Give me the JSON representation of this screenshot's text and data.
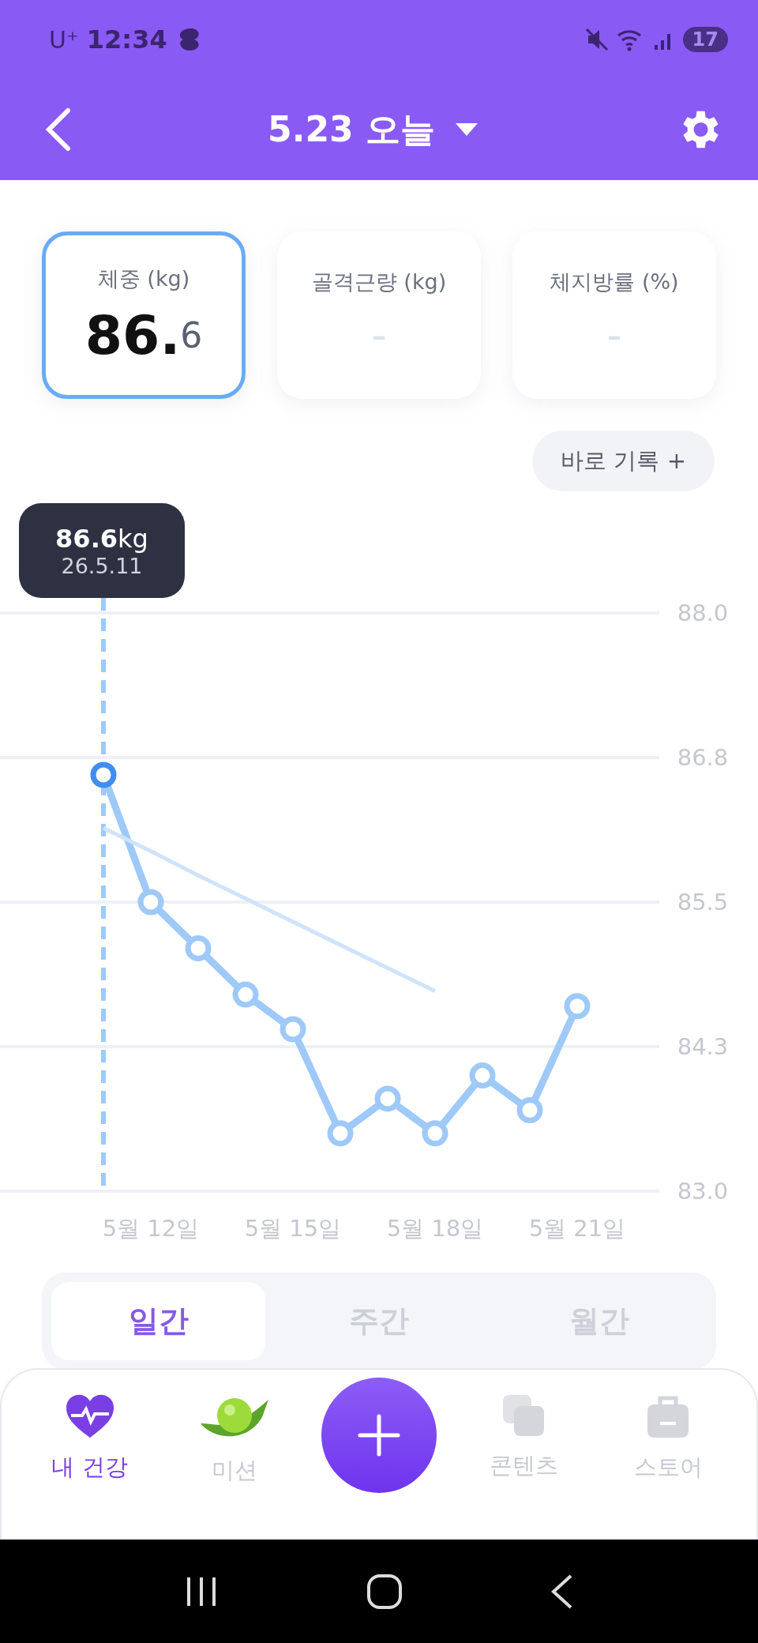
{
  "status_bar": {
    "carrier": "U⁺",
    "time": "12:34",
    "battery": "17"
  },
  "header": {
    "title": "5.23 오늘"
  },
  "metrics": [
    {
      "label": "체중 (kg)",
      "value": "**86.**6",
      "selected": true
    },
    {
      "label": "골격근량 (kg)",
      "value": "-",
      "selected": false
    },
    {
      "label": "체지방률 (%)",
      "value": "-",
      "selected": false
    }
  ],
  "quick_record": {
    "label": "바로 기록 +"
  },
  "tooltip": {
    "value": "**86.6**kg",
    "date": "26.5.11"
  },
  "chart_data": {
    "type": "line",
    "categories": [
      null,
      "5월 12일",
      null,
      null,
      "5월 15일",
      null,
      null,
      "5월 18일",
      null,
      null,
      "5월 21일"
    ],
    "ylim": [
      83,
      88
    ],
    "grid": true,
    "yticks": [
      {
        "value": 88,
        "label": "88.0"
      },
      {
        "value": 86.75,
        "label": "86.8"
      },
      {
        "value": 85.5,
        "label": "85.5"
      },
      {
        "value": 84.25,
        "label": "84.3"
      },
      {
        "value": 83,
        "label": "83.0"
      }
    ],
    "series": [
      {
        "color": "#9ec9f8",
        "marker": true,
        "values": [
          86.6,
          85.5,
          85.1,
          84.7,
          84.4,
          83.5,
          83.8,
          83.5,
          84.0,
          83.7,
          84.6
        ]
      },
      {
        "color": "#cfe3fb",
        "values": [
          86.14,
          85.94,
          85.73,
          85.53,
          85.33,
          85.13,
          84.93,
          84.73,
          null,
          null,
          null
        ]
      }
    ]
  },
  "period_tabs": [
    {
      "label": "일간",
      "selected": true
    },
    {
      "label": "주간",
      "selected": false
    },
    {
      "label": "월간",
      "selected": false
    }
  ],
  "nav": [
    {
      "kind": "heart",
      "label": "내 건강",
      "selected": true
    },
    {
      "kind": "pea",
      "label": "미션",
      "selected": false
    },
    {
      "kind": "add",
      "selected": false
    },
    {
      "kind": "pages",
      "label": "콘텐츠",
      "selected": false
    },
    {
      "kind": "bag",
      "label": "스토어",
      "selected": false
    }
  ]
}
